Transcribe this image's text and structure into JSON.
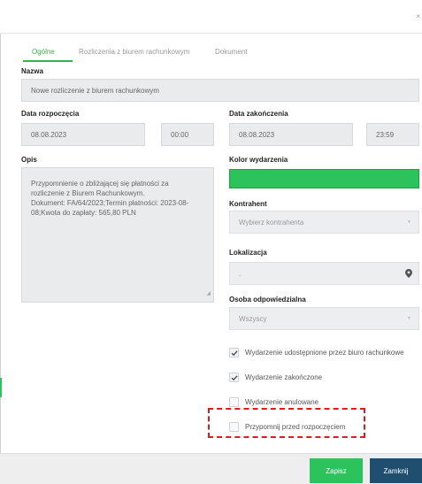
{
  "dialog": {
    "close_glyph": "×"
  },
  "tabs": [
    {
      "label": "Ogólne"
    },
    {
      "label": "Rozliczenia z biurem rachunkowym"
    },
    {
      "label": "Dokument"
    }
  ],
  "form": {
    "name_label": "Nazwa",
    "name_value": "Nowe rozliczenie z biurem rachunkowym",
    "start_label": "Data rozpoczęcia",
    "start_date": "08.08.2023",
    "start_time": "00:00",
    "end_label": "Data zakończenia",
    "end_date": "08.08.2023",
    "end_time": "23:59",
    "desc_label": "Opis",
    "desc_lines": [
      "Przypomnienie o zbliżającej się płatności za",
      "rozliczenie z Biurem Rachunkowym.",
      "Dokument: FA/64/2023;Termin płatności: 2023-08-",
      "08;Kwota do zapłaty: 565,80 PLN"
    ],
    "color_label": "Kolor wydarzenia",
    "color_value": "#2dc35c",
    "contractor_label": "Kontrahent",
    "contractor_placeholder": "Wybierz kontrahenta",
    "location_label": "Lokalizacja",
    "location_value": ".",
    "owner_label": "Osoba odpowiedzialna",
    "owner_value": "Wszyscy"
  },
  "checkboxes": [
    {
      "label": "Wydarzenie udostępnione przez biuro rachunkowe",
      "checked": true
    },
    {
      "label": "Wydarzenie zakończone",
      "checked": true
    },
    {
      "label": "Wydarzenie anulowane",
      "checked": false
    },
    {
      "label": "Przypomnij przed rozpoczęciem",
      "checked": false
    }
  ],
  "buttons": {
    "save": "Zapisz",
    "close": "Zamknij"
  },
  "colors": {
    "accent_green": "#2dc35c",
    "tab_active": "#2db84d",
    "close_button": "#1f4e6e",
    "highlight_dash": "#e01b1b"
  }
}
